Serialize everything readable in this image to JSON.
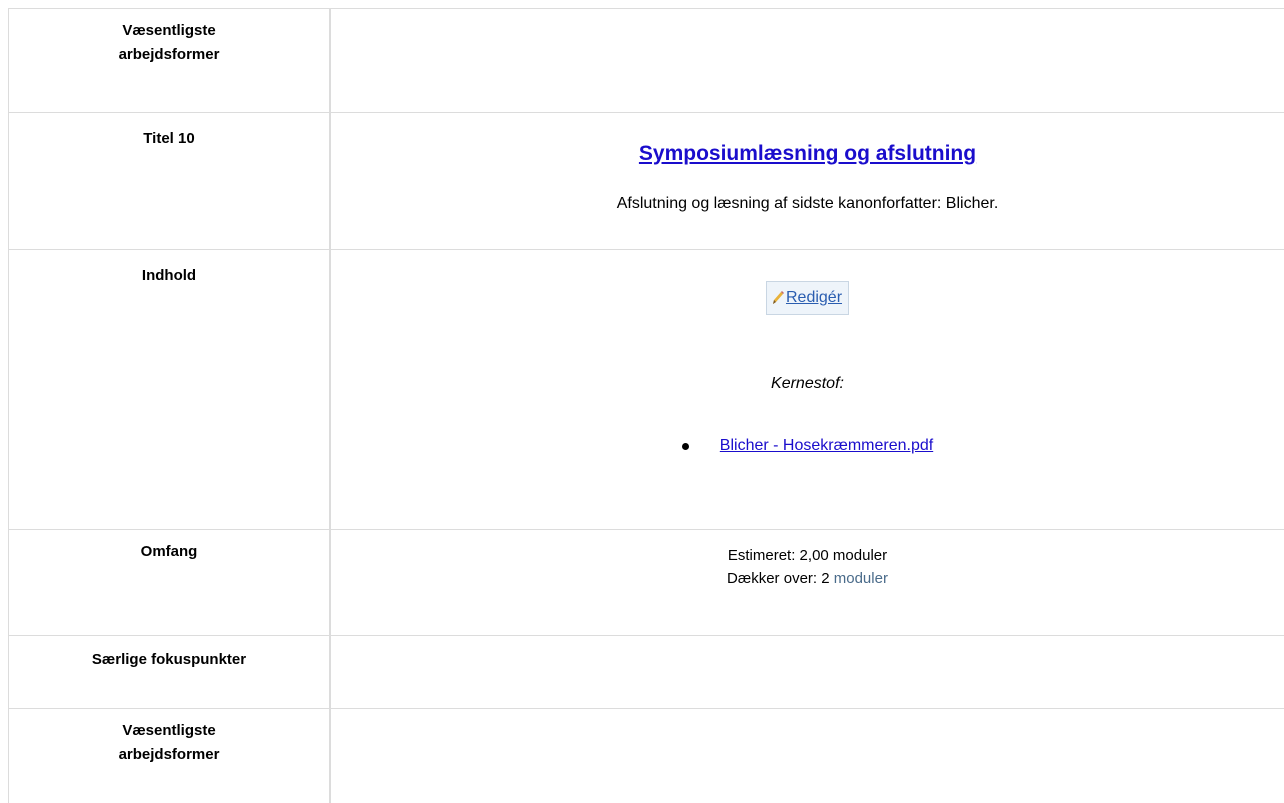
{
  "rows": {
    "top": {
      "label": "Væsentligste arbejdsformer"
    },
    "titel": {
      "label": "Titel 10",
      "title_link": "Symposiumlæsning og afslutning",
      "description": "Afslutning og læsning af sidste kanonforfatter: Blicher."
    },
    "indhold": {
      "label": "Indhold",
      "edit_label": "Redigér",
      "kernestof_label": "Kernestof:",
      "files": [
        "Blicher - Hosekræmmeren.pdf"
      ]
    },
    "omfang": {
      "label": "Omfang",
      "estimeret": "Estimeret: 2,00 moduler",
      "daekker_prefix": "Dækker over: 2 ",
      "daekker_link": "moduler"
    },
    "fokus": {
      "label": "Særlige fokuspunkter"
    },
    "bottom": {
      "label": "Væsentligste arbejdsformer"
    }
  },
  "icons": {
    "edit": "pencil-icon"
  },
  "colors": {
    "link": "#1a0dcc",
    "edit_link": "#2a5db0",
    "moduler_link": "#4a6b8a",
    "border": "#dcdcdc"
  }
}
